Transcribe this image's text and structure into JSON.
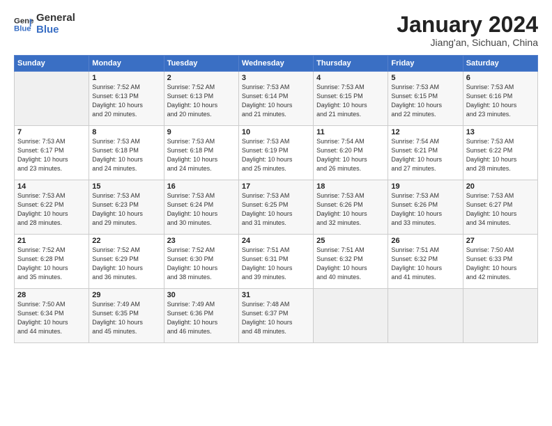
{
  "logo": {
    "line1": "General",
    "line2": "Blue"
  },
  "title": "January 2024",
  "subtitle": "Jiang'an, Sichuan, China",
  "days_header": [
    "Sunday",
    "Monday",
    "Tuesday",
    "Wednesday",
    "Thursday",
    "Friday",
    "Saturday"
  ],
  "weeks": [
    [
      {
        "num": "",
        "info": ""
      },
      {
        "num": "1",
        "info": "Sunrise: 7:52 AM\nSunset: 6:13 PM\nDaylight: 10 hours\nand 20 minutes."
      },
      {
        "num": "2",
        "info": "Sunrise: 7:52 AM\nSunset: 6:13 PM\nDaylight: 10 hours\nand 20 minutes."
      },
      {
        "num": "3",
        "info": "Sunrise: 7:53 AM\nSunset: 6:14 PM\nDaylight: 10 hours\nand 21 minutes."
      },
      {
        "num": "4",
        "info": "Sunrise: 7:53 AM\nSunset: 6:15 PM\nDaylight: 10 hours\nand 21 minutes."
      },
      {
        "num": "5",
        "info": "Sunrise: 7:53 AM\nSunset: 6:15 PM\nDaylight: 10 hours\nand 22 minutes."
      },
      {
        "num": "6",
        "info": "Sunrise: 7:53 AM\nSunset: 6:16 PM\nDaylight: 10 hours\nand 23 minutes."
      }
    ],
    [
      {
        "num": "7",
        "info": "Sunrise: 7:53 AM\nSunset: 6:17 PM\nDaylight: 10 hours\nand 23 minutes."
      },
      {
        "num": "8",
        "info": "Sunrise: 7:53 AM\nSunset: 6:18 PM\nDaylight: 10 hours\nand 24 minutes."
      },
      {
        "num": "9",
        "info": "Sunrise: 7:53 AM\nSunset: 6:18 PM\nDaylight: 10 hours\nand 24 minutes."
      },
      {
        "num": "10",
        "info": "Sunrise: 7:53 AM\nSunset: 6:19 PM\nDaylight: 10 hours\nand 25 minutes."
      },
      {
        "num": "11",
        "info": "Sunrise: 7:54 AM\nSunset: 6:20 PM\nDaylight: 10 hours\nand 26 minutes."
      },
      {
        "num": "12",
        "info": "Sunrise: 7:54 AM\nSunset: 6:21 PM\nDaylight: 10 hours\nand 27 minutes."
      },
      {
        "num": "13",
        "info": "Sunrise: 7:53 AM\nSunset: 6:22 PM\nDaylight: 10 hours\nand 28 minutes."
      }
    ],
    [
      {
        "num": "14",
        "info": "Sunrise: 7:53 AM\nSunset: 6:22 PM\nDaylight: 10 hours\nand 28 minutes."
      },
      {
        "num": "15",
        "info": "Sunrise: 7:53 AM\nSunset: 6:23 PM\nDaylight: 10 hours\nand 29 minutes."
      },
      {
        "num": "16",
        "info": "Sunrise: 7:53 AM\nSunset: 6:24 PM\nDaylight: 10 hours\nand 30 minutes."
      },
      {
        "num": "17",
        "info": "Sunrise: 7:53 AM\nSunset: 6:25 PM\nDaylight: 10 hours\nand 31 minutes."
      },
      {
        "num": "18",
        "info": "Sunrise: 7:53 AM\nSunset: 6:26 PM\nDaylight: 10 hours\nand 32 minutes."
      },
      {
        "num": "19",
        "info": "Sunrise: 7:53 AM\nSunset: 6:26 PM\nDaylight: 10 hours\nand 33 minutes."
      },
      {
        "num": "20",
        "info": "Sunrise: 7:53 AM\nSunset: 6:27 PM\nDaylight: 10 hours\nand 34 minutes."
      }
    ],
    [
      {
        "num": "21",
        "info": "Sunrise: 7:52 AM\nSunset: 6:28 PM\nDaylight: 10 hours\nand 35 minutes."
      },
      {
        "num": "22",
        "info": "Sunrise: 7:52 AM\nSunset: 6:29 PM\nDaylight: 10 hours\nand 36 minutes."
      },
      {
        "num": "23",
        "info": "Sunrise: 7:52 AM\nSunset: 6:30 PM\nDaylight: 10 hours\nand 38 minutes."
      },
      {
        "num": "24",
        "info": "Sunrise: 7:51 AM\nSunset: 6:31 PM\nDaylight: 10 hours\nand 39 minutes."
      },
      {
        "num": "25",
        "info": "Sunrise: 7:51 AM\nSunset: 6:32 PM\nDaylight: 10 hours\nand 40 minutes."
      },
      {
        "num": "26",
        "info": "Sunrise: 7:51 AM\nSunset: 6:32 PM\nDaylight: 10 hours\nand 41 minutes."
      },
      {
        "num": "27",
        "info": "Sunrise: 7:50 AM\nSunset: 6:33 PM\nDaylight: 10 hours\nand 42 minutes."
      }
    ],
    [
      {
        "num": "28",
        "info": "Sunrise: 7:50 AM\nSunset: 6:34 PM\nDaylight: 10 hours\nand 44 minutes."
      },
      {
        "num": "29",
        "info": "Sunrise: 7:49 AM\nSunset: 6:35 PM\nDaylight: 10 hours\nand 45 minutes."
      },
      {
        "num": "30",
        "info": "Sunrise: 7:49 AM\nSunset: 6:36 PM\nDaylight: 10 hours\nand 46 minutes."
      },
      {
        "num": "31",
        "info": "Sunrise: 7:48 AM\nSunset: 6:37 PM\nDaylight: 10 hours\nand 48 minutes."
      },
      {
        "num": "",
        "info": ""
      },
      {
        "num": "",
        "info": ""
      },
      {
        "num": "",
        "info": ""
      }
    ]
  ]
}
